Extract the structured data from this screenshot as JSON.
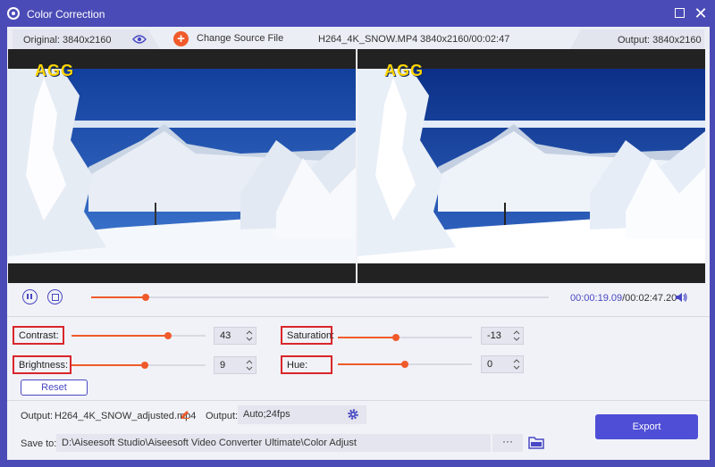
{
  "titlebar": {
    "title": "Color Correction"
  },
  "infobar": {
    "original": "Original: 3840x2160",
    "change_source": "Change Source File",
    "filename": "H264_4K_SNOW.MP4",
    "duration": "3840x2160/00:02:47",
    "output": "Output: 3840x2160"
  },
  "video": {
    "logo_text": "AGG"
  },
  "playback": {
    "current_time": "00:00:19.09",
    "total_time": "/00:02:47.20",
    "progress": 0.12
  },
  "adjust": {
    "contrast": {
      "label": "Contrast:",
      "value": "43",
      "level": 0.72
    },
    "brightness": {
      "label": "Brightness:",
      "value": "9",
      "level": 0.545
    },
    "saturation": {
      "label": "Saturation:",
      "value": "-13",
      "level": 0.435
    },
    "hue": {
      "label": "Hue:",
      "value": "0",
      "level": 0.5
    },
    "reset_label": "Reset"
  },
  "output": {
    "output_label": "Output:",
    "output_file": "H264_4K_SNOW_adjusted.mp4",
    "format_label": "Output:",
    "format_value": "Auto;24fps",
    "save_label": "Save to:",
    "save_path": "D:\\Aiseesoft Studio\\Aiseesoft Video Converter Ultimate\\Color Adjust",
    "more_label": "···",
    "export_label": "Export"
  },
  "colors": {
    "accent": "#f05a2a",
    "brand": "#4b4bb7",
    "highlight": "#d8262b"
  }
}
